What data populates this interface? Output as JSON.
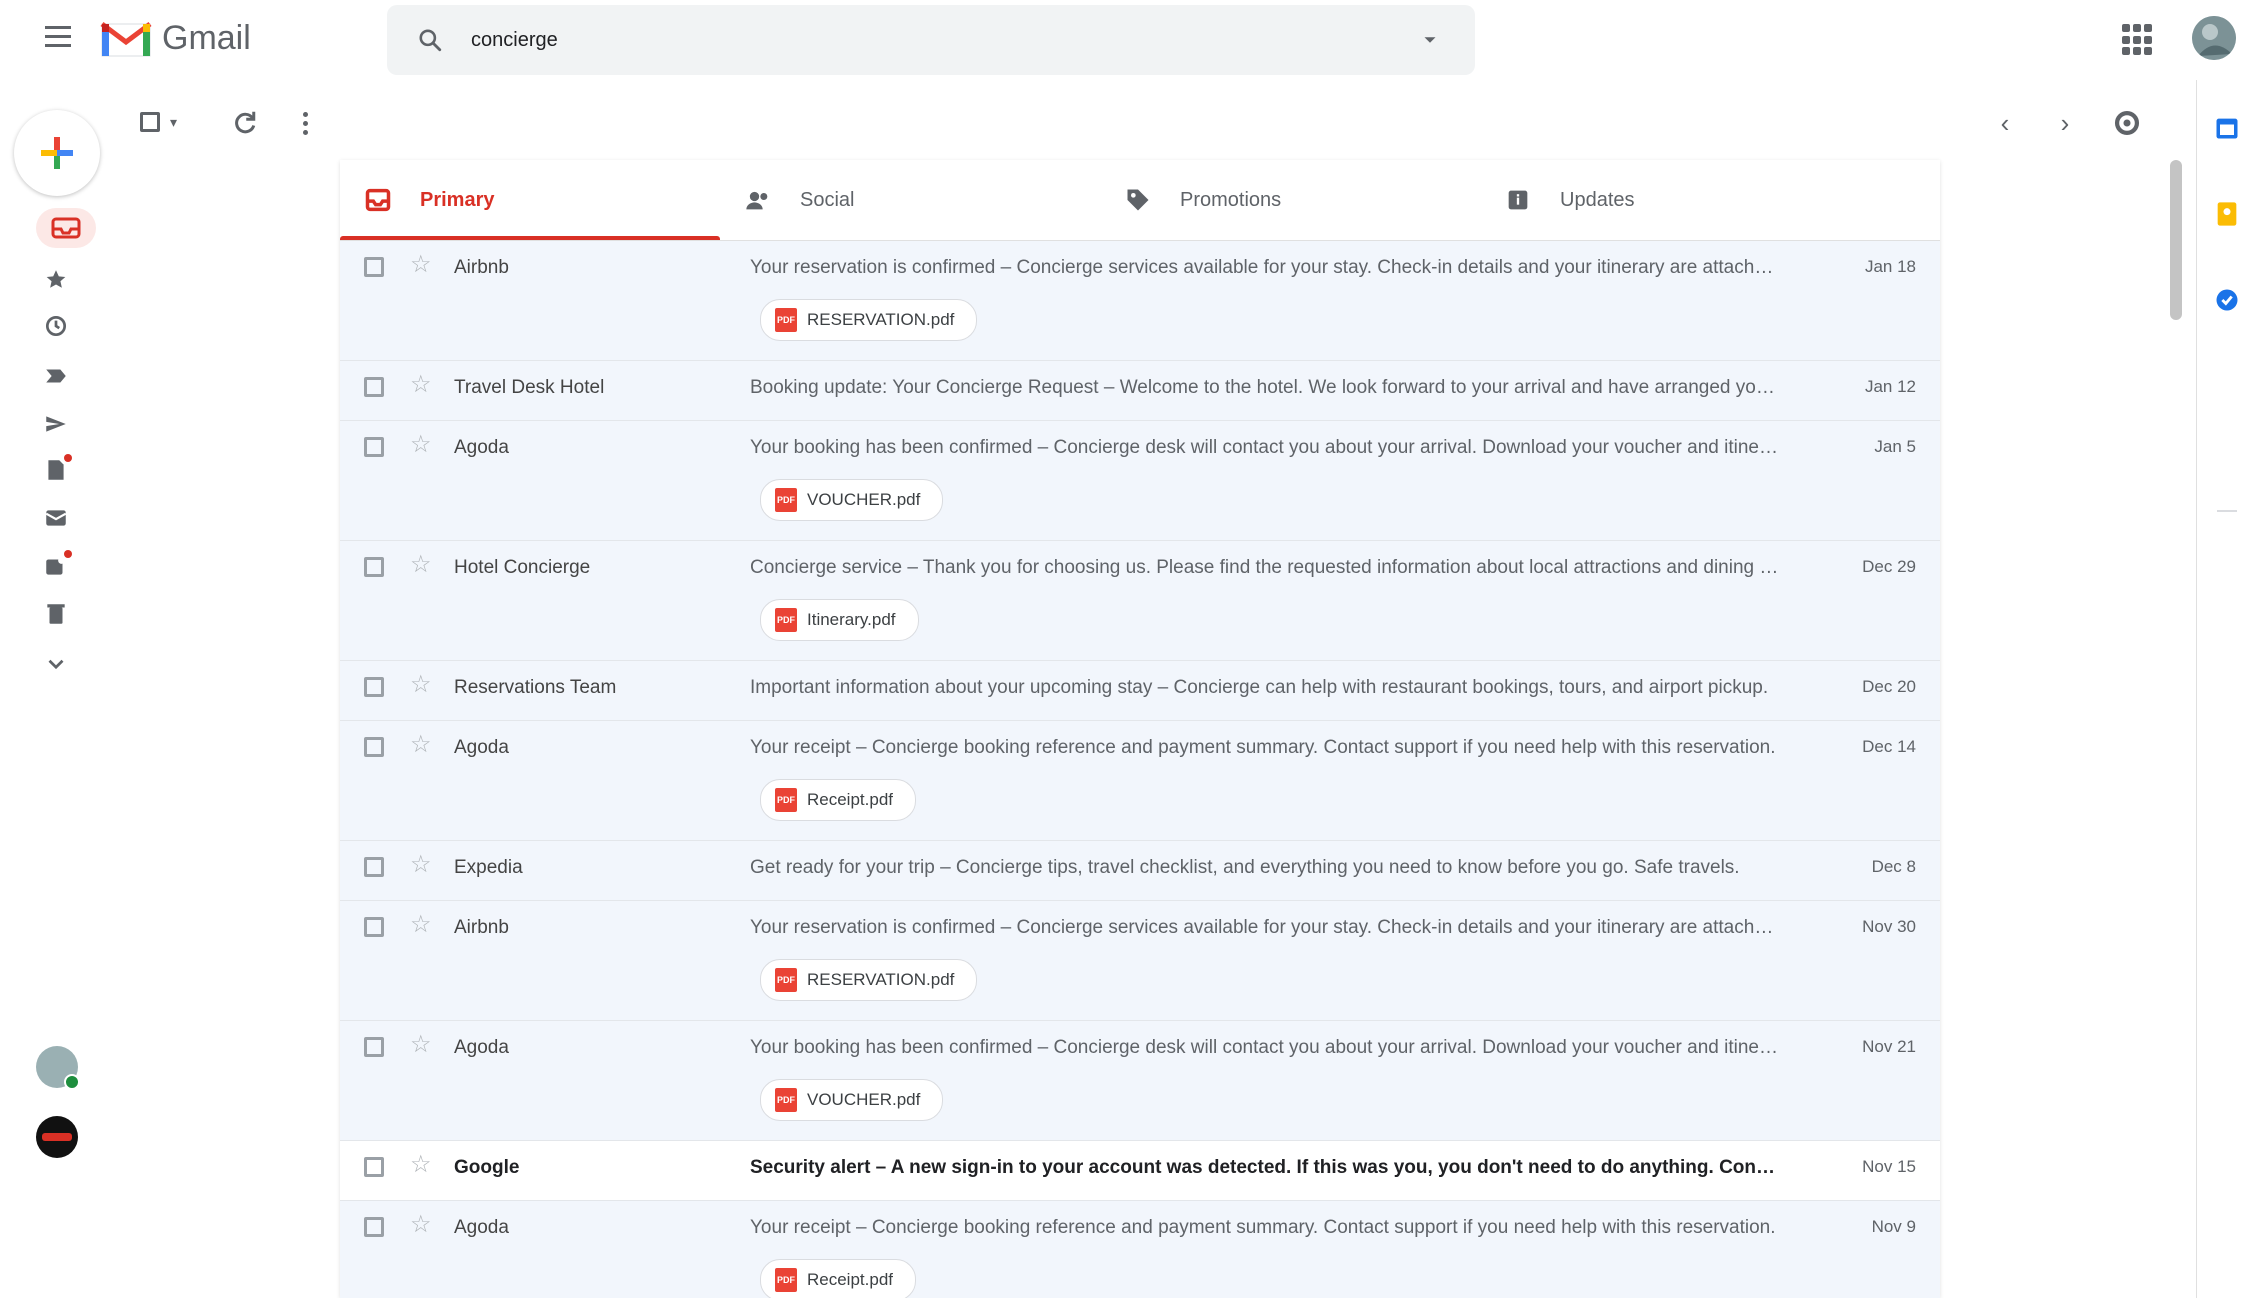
{
  "app": {
    "logo_text": "Gmail",
    "search_value": "concierge"
  },
  "colors": {
    "accent": "#d93025",
    "row_read_bg": "#f2f6fc",
    "row_unread_bg": "#ffffff"
  },
  "tabs": [
    {
      "label": "Primary",
      "icon": "inbox-icon",
      "active": true
    },
    {
      "label": "Social",
      "icon": "people-icon",
      "active": false
    },
    {
      "label": "Promotions",
      "icon": "tag-icon",
      "active": false
    },
    {
      "label": "Updates",
      "icon": "info-icon",
      "active": false
    }
  ],
  "emails": [
    {
      "sender": "Airbnb",
      "subject": "Your reservation is confirmed – Concierge services available for your stay. Check-in details and your itinerary are attached.",
      "date": "Jan 18",
      "attachment": "RESERVATION.pdf",
      "read": true,
      "height": "tall"
    },
    {
      "sender": "Travel Desk Hotel",
      "subject": "Booking update: Your Concierge Request – Welcome to the hotel. We look forward to your arrival and have arranged your transfers.",
      "date": "Jan 12",
      "attachment": null,
      "read": true,
      "height": "short"
    },
    {
      "sender": "Agoda",
      "subject": "Your booking has been confirmed – Concierge desk will contact you about your arrival. Download your voucher and itinerary.",
      "date": "Jan 5",
      "attachment": "VOUCHER.pdf",
      "read": true,
      "height": "tall"
    },
    {
      "sender": "Hotel Concierge",
      "subject": "Concierge service – Thank you for choosing us. Please find the requested information about local attractions and dining options.",
      "date": "Dec 29",
      "attachment": "Itinerary.pdf",
      "read": true,
      "height": "tall"
    },
    {
      "sender": "Reservations Team",
      "subject": "Important information about your upcoming stay – Concierge can help with restaurant bookings, tours, and airport pickup.",
      "date": "Dec 20",
      "attachment": null,
      "read": true,
      "height": "short"
    },
    {
      "sender": "Agoda",
      "subject": "Your receipt – Concierge booking reference and payment summary. Contact support if you need help with this reservation.",
      "date": "Dec 14",
      "attachment": "Receipt.pdf",
      "read": true,
      "height": "tall"
    },
    {
      "sender": "Expedia",
      "subject": "Get ready for your trip – Concierge tips, travel checklist, and everything you need to know before you go. Safe travels.",
      "date": "Dec 8",
      "attachment": null,
      "read": true,
      "height": "short"
    },
    {
      "sender": "Airbnb",
      "subject": "Your reservation is confirmed – Concierge services available for your stay. Check-in details and your itinerary are attached.",
      "date": "Nov 30",
      "attachment": "RESERVATION.pdf",
      "read": true,
      "height": "tall"
    },
    {
      "sender": "Agoda",
      "subject": "Your booking has been confirmed – Concierge desk will contact you about your arrival. Download your voucher and itinerary.",
      "date": "Nov 21",
      "attachment": "VOUCHER.pdf",
      "read": true,
      "height": "tall"
    },
    {
      "sender": "Google",
      "subject": "Security alert – A new sign-in to your account was detected. If this was you, you don't need to do anything. Concierge access.",
      "date": "Nov 15",
      "attachment": null,
      "read": false,
      "height": "short"
    },
    {
      "sender": "Agoda",
      "subject": "Your receipt – Concierge booking reference and payment summary. Contact support if you need help with this reservation.",
      "date": "Nov 9",
      "attachment": "Receipt.pdf",
      "read": true,
      "height": "tall"
    }
  ]
}
